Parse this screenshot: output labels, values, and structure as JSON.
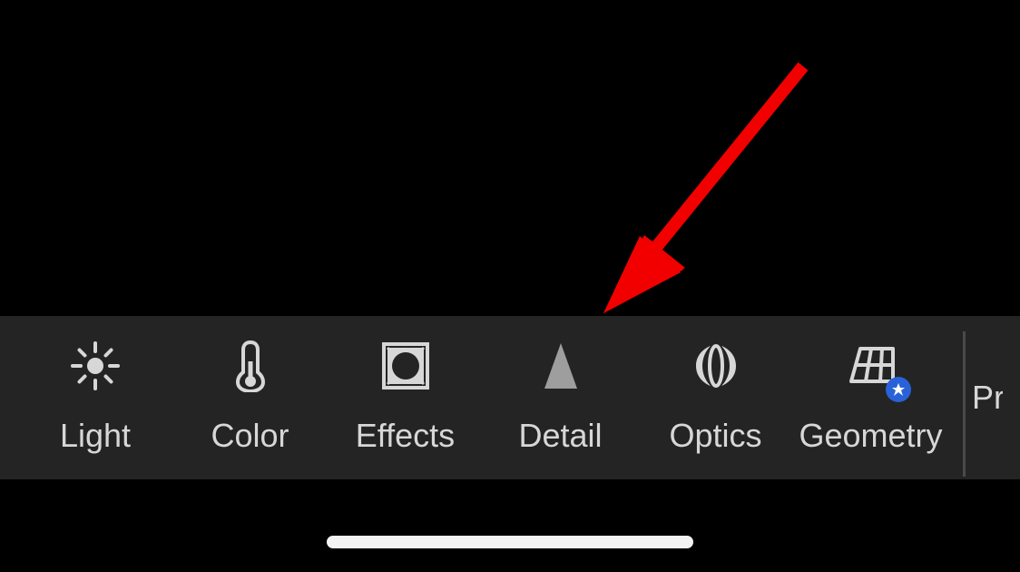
{
  "toolbar": {
    "items": [
      {
        "id": "light",
        "label": "Light",
        "icon": "sun-icon"
      },
      {
        "id": "color",
        "label": "Color",
        "icon": "thermometer-icon"
      },
      {
        "id": "effects",
        "label": "Effects",
        "icon": "vignette-icon"
      },
      {
        "id": "detail",
        "label": "Detail",
        "icon": "triangle-icon"
      },
      {
        "id": "optics",
        "label": "Optics",
        "icon": "lens-icon"
      },
      {
        "id": "geometry",
        "label": "Geometry",
        "icon": "perspective-icon",
        "badge": "star-badge"
      }
    ],
    "partial_next_label": "Pr"
  },
  "annotation": {
    "type": "arrow",
    "color": "#f20000",
    "target": "detail"
  }
}
